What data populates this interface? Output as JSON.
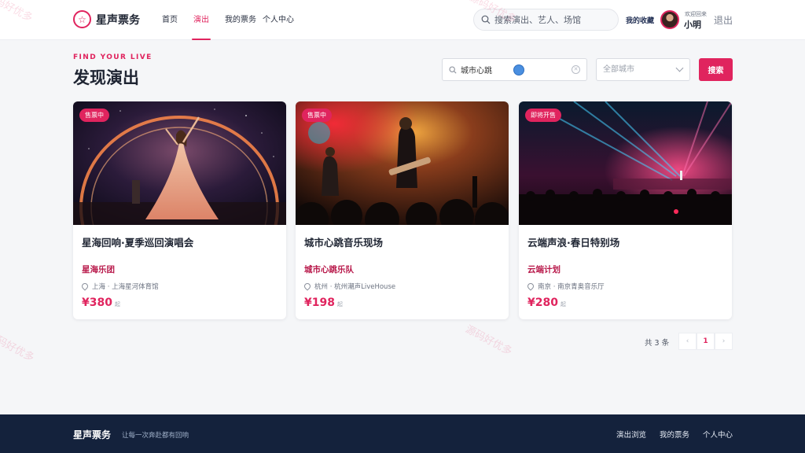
{
  "header": {
    "brand": "星声票务",
    "nav": [
      {
        "label": "首页",
        "active": false
      },
      {
        "label": "演出",
        "active": true
      },
      {
        "label": "我的票务",
        "active": false
      },
      {
        "label": "个人中心",
        "active": false
      }
    ],
    "search_placeholder": "搜索演出、艺人、场馆",
    "favorites": "我的收藏",
    "welcome": "欢迎回来",
    "username": "小明",
    "logout": "退出"
  },
  "hero": {
    "eyebrow": "FIND YOUR LIVE",
    "title": "发现演出"
  },
  "filters": {
    "keyword": "城市心跳",
    "city_placeholder": "全部城市",
    "search_button": "搜索"
  },
  "cards": [
    {
      "badge": "售票中",
      "title": "星海回响·夏季巡回演唱会",
      "artist": "星海乐团",
      "venue": "上海 · 上海星河体育馆",
      "price": "¥380",
      "price_unit": "起"
    },
    {
      "badge": "售票中",
      "title": "城市心跳音乐现场",
      "artist": "城市心跳乐队",
      "venue": "杭州 · 杭州潮声LiveHouse",
      "price": "¥198",
      "price_unit": "起"
    },
    {
      "badge": "即将开售",
      "title": "云端声浪·春日特别场",
      "artist": "云端计划",
      "venue": "南京 · 南京青奥音乐厅",
      "price": "¥280",
      "price_unit": "起"
    }
  ],
  "pagination": {
    "total": "共 3 条",
    "prev": "‹",
    "current": "1",
    "next": "›"
  },
  "footer": {
    "brand": "星声票务",
    "slogan": "让每一次奔赴都有回响",
    "links": [
      "演出浏览",
      "我的票务",
      "个人中心"
    ]
  },
  "watermark": "源码好优多",
  "colors": {
    "accent": "#e0245e",
    "footer_bg": "#14223c",
    "page_bg": "#f5f6f8"
  },
  "icons": [
    "star-logo-icon",
    "search-icon",
    "clear-icon",
    "chevron-down-icon",
    "location-pin-icon"
  ]
}
